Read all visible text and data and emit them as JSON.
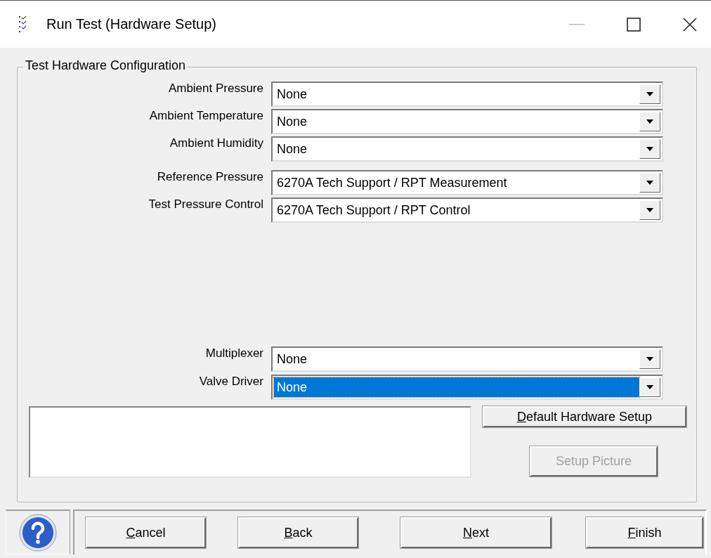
{
  "window": {
    "title": "Run Test (Hardware Setup)"
  },
  "group_box": {
    "title": "Test Hardware Configuration",
    "sections": [
      {
        "fields": [
          {
            "label": "Ambient Pressure",
            "value": "None",
            "focused": false
          },
          {
            "label": "Ambient Temperature",
            "value": "None",
            "focused": false
          },
          {
            "label": "Ambient Humidity",
            "value": "None",
            "focused": false
          }
        ]
      },
      {
        "fields": [
          {
            "label": "Reference Pressure",
            "value": "6270A Tech Support / RPT Measurement",
            "focused": false
          },
          {
            "label": "Test Pressure Control",
            "value": "6270A Tech Support / RPT Control",
            "focused": false
          }
        ]
      },
      {
        "fields": [
          {
            "label": "Multiplexer",
            "value": "None",
            "focused": false
          },
          {
            "label": "Valve Driver",
            "value": "None",
            "focused": true
          }
        ]
      }
    ],
    "default_button": {
      "label": "Default Hardware Setup",
      "disabled": false,
      "underline_first": true
    },
    "picture_button": {
      "label": "Setup Picture",
      "disabled": true,
      "underline_first": false
    }
  },
  "buttons": [
    {
      "label": "Cancel",
      "underline_first": true
    },
    {
      "label": "Back",
      "underline_first": true
    },
    {
      "label": "Next",
      "underline_first": true
    },
    {
      "label": "Finish",
      "underline_first": true
    }
  ]
}
